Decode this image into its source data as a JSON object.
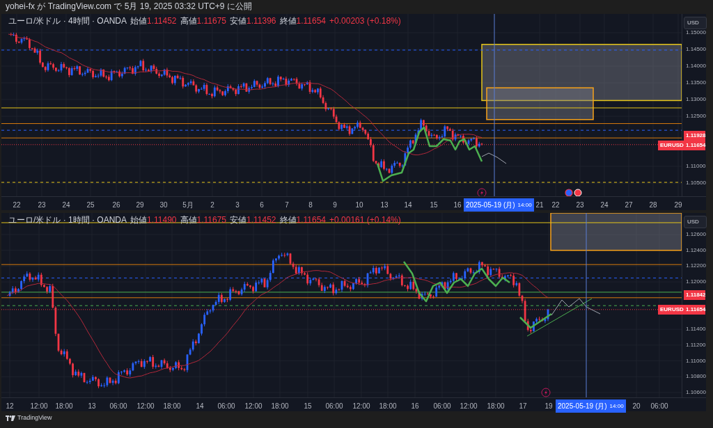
{
  "header": {
    "text": "yohei-fx が TradingView.com で 5月 19, 2025 03:32 UTC+9 に公開"
  },
  "panes": [
    {
      "legend": {
        "title": "ユーロ/米ドル · 4時間 · OANDA",
        "fields": [
          {
            "label": "始値",
            "value": "1.11452"
          },
          {
            "label": "高値",
            "value": "1.11675"
          },
          {
            "label": "安値",
            "value": "1.11396"
          },
          {
            "label": "終値",
            "value": "1.11654"
          }
        ],
        "change": "+0.00203 (+0.18%)"
      },
      "currency": "USD",
      "price_ticks": [
        "1.15000",
        "1.14500",
        "1.14000",
        "1.13500",
        "1.13000",
        "1.12500",
        "1.11000",
        "1.10500"
      ],
      "price_labels": [
        {
          "kind": "level",
          "value": "1.11928"
        },
        {
          "kind": "last",
          "symbol": "EURUSD",
          "value": "1.11654"
        }
      ],
      "time_ticks": [
        "22",
        "23",
        "24",
        "25",
        "26",
        "29",
        "30",
        "5月",
        "2",
        "3",
        "6",
        "7",
        "8",
        "9",
        "10",
        "13",
        "14",
        "15",
        "16",
        "21",
        "22",
        "23",
        "24",
        "27",
        "28",
        "29"
      ],
      "cursor": {
        "date": "2025-05-19 (月)",
        "time": "14:00"
      }
    },
    {
      "legend": {
        "title": "ユーロ/米ドル · 1時間 · OANDA",
        "fields": [
          {
            "label": "始値",
            "value": "1.11490"
          },
          {
            "label": "高値",
            "value": "1.11675"
          },
          {
            "label": "安値",
            "value": "1.11452"
          },
          {
            "label": "終値",
            "value": "1.11654"
          }
        ],
        "change": "+0.00161 (+0.14%)"
      },
      "currency": "USD",
      "price_ticks": [
        "1.12600",
        "1.12400",
        "1.12200",
        "1.12000",
        "1.11400",
        "1.11200",
        "1.11000",
        "1.10800",
        "1.10600"
      ],
      "price_labels": [
        {
          "kind": "level",
          "value": "1.11842"
        },
        {
          "kind": "last",
          "symbol": "EURUSD",
          "value": "1.11654"
        }
      ],
      "time_ticks": [
        "12",
        "12:00",
        "18:00",
        "13",
        "06:00",
        "12:00",
        "18:00",
        "14",
        "06:00",
        "12:00",
        "18:00",
        "15",
        "06:00",
        "12:00",
        "18:00",
        "16",
        "06:00",
        "12:00",
        "18:00",
        "17",
        "19",
        "20",
        "06:00"
      ],
      "cursor": {
        "date": "2025-05-19 (月)",
        "time": "14:00"
      }
    }
  ],
  "footer": {
    "brand": "TradingView"
  }
}
